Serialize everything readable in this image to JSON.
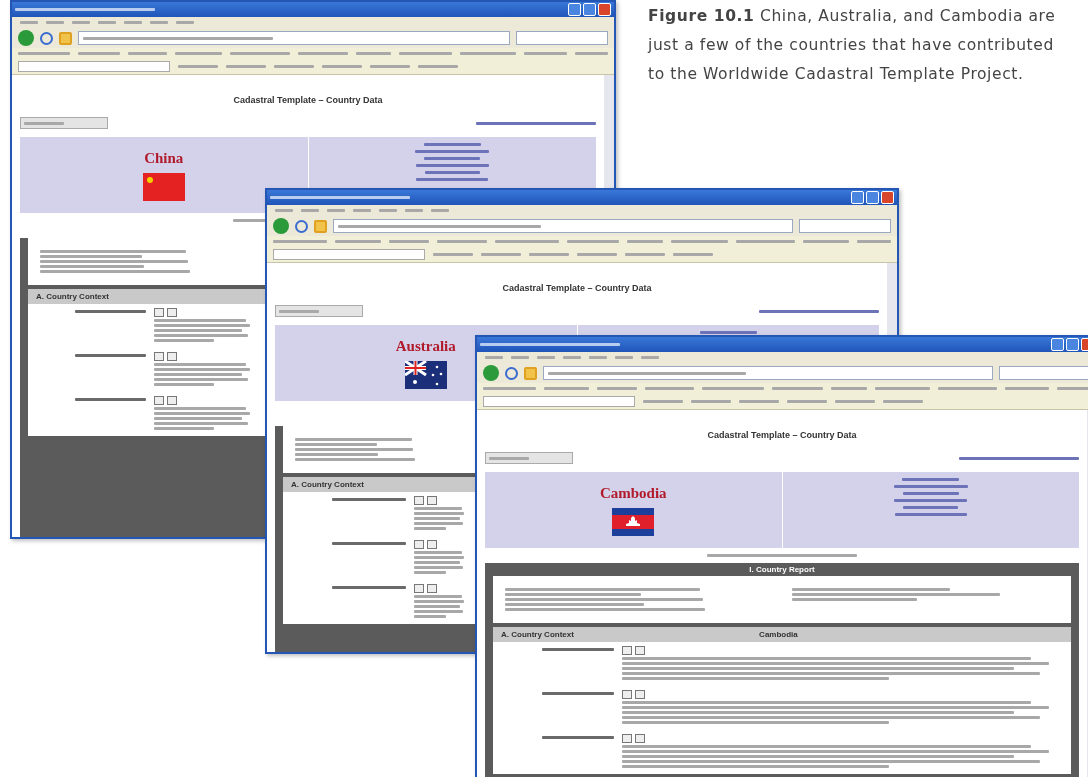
{
  "caption": "**Figure 10.1** China, Australia, and Cambodia are just a few of the countries that have contributed to the Worldwide Cadastral Template Project.",
  "windows": [
    {
      "heading": "Cadastral Template – Country Data",
      "country": "China",
      "kind": "china",
      "section_title": "A. Country Context"
    },
    {
      "heading": "Cadastral Template – Country Data",
      "country": "Australia",
      "kind": "australia",
      "section_title": "A. Country Context"
    },
    {
      "heading": "Cadastral Template – Country Data",
      "country": "Cambodia",
      "kind": "cambodia",
      "band_title": "I. Country Report",
      "section_title": "A. Country Context",
      "section_country": "Cambodia"
    }
  ]
}
